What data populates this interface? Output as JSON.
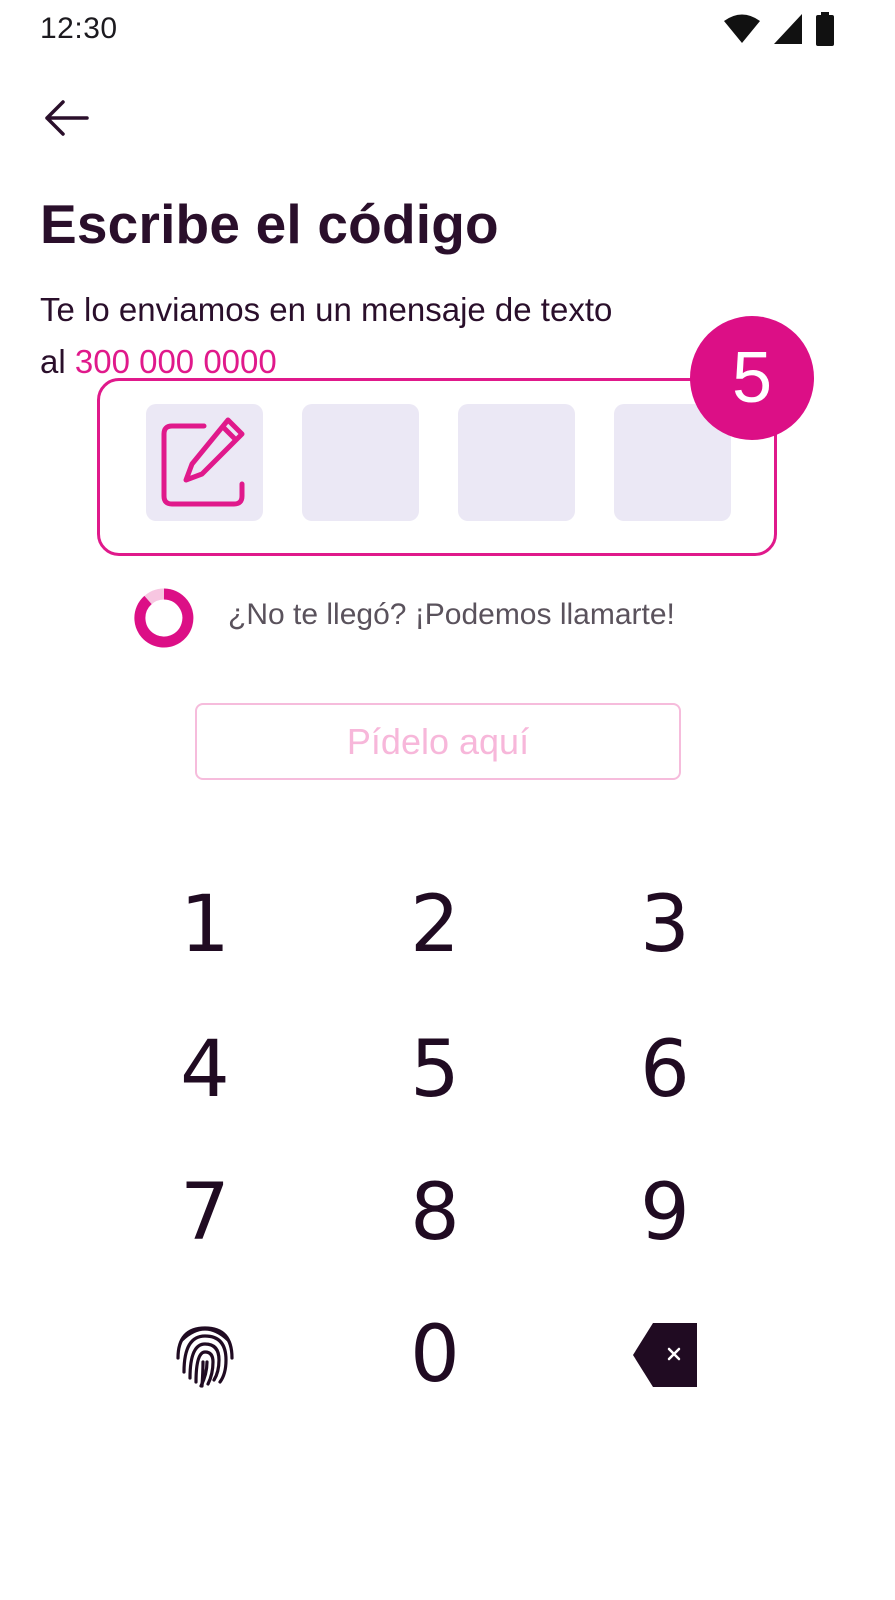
{
  "status_bar": {
    "time": "12:30",
    "icons": [
      "wifi-icon",
      "signal-icon",
      "battery-icon"
    ]
  },
  "header": {
    "back_icon": "arrow-left-icon"
  },
  "main": {
    "title": "Escribe el código",
    "subtitle_line1": "Te lo enviamos en un mensaje de texto",
    "subtitle_prefix": "al",
    "phone_number": "300 000 0000",
    "code_cells": [
      "",
      "",
      "",
      ""
    ],
    "active_cell_icon": "edit-icon",
    "step_badge": "5",
    "resend_text": "¿No te llegó? ¡Podemos llamarte!",
    "resend_icon": "progress-ring-icon",
    "request_button_label": "Pídelo aquí"
  },
  "keypad": {
    "keys": [
      "1",
      "2",
      "3",
      "4",
      "5",
      "6",
      "7",
      "8",
      "9",
      "0"
    ],
    "biometric_icon": "fingerprint-icon",
    "delete_icon": "backspace-icon"
  },
  "colors": {
    "accent": "#e0198b",
    "text_dark": "#2a0f2b",
    "cell_bg": "#ebe8f5",
    "button_border_disabled": "#f6bcdc"
  }
}
